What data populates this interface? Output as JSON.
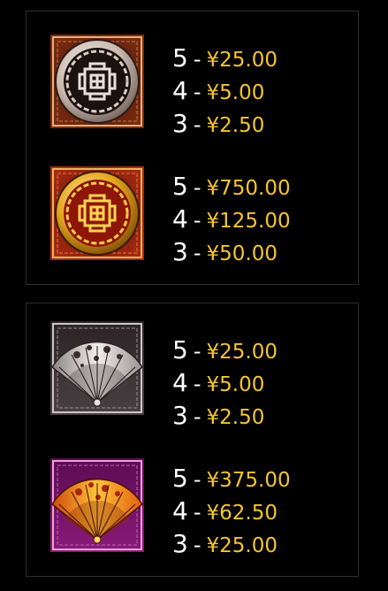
{
  "colors": {
    "background": "#000000",
    "count": "#ffffff",
    "amount": "#f5c431",
    "border": "#2e2e2e"
  },
  "groups": [
    {
      "entries": [
        {
          "symbol": "silver-coin-icon",
          "pays": [
            {
              "count": "5",
              "amount": "¥25.00"
            },
            {
              "count": "4",
              "amount": "¥5.00"
            },
            {
              "count": "3",
              "amount": "¥2.50"
            }
          ]
        },
        {
          "symbol": "gold-coin-icon",
          "pays": [
            {
              "count": "5",
              "amount": "¥750.00"
            },
            {
              "count": "4",
              "amount": "¥125.00"
            },
            {
              "count": "3",
              "amount": "¥50.00"
            }
          ]
        }
      ]
    },
    {
      "entries": [
        {
          "symbol": "silver-fan-icon",
          "pays": [
            {
              "count": "5",
              "amount": "¥25.00"
            },
            {
              "count": "4",
              "amount": "¥5.00"
            },
            {
              "count": "3",
              "amount": "¥2.50"
            }
          ]
        },
        {
          "symbol": "gold-fan-icon",
          "pays": [
            {
              "count": "5",
              "amount": "¥375.00"
            },
            {
              "count": "4",
              "amount": "¥62.50"
            },
            {
              "count": "3",
              "amount": "¥25.00"
            }
          ]
        }
      ]
    }
  ],
  "dash": "-"
}
